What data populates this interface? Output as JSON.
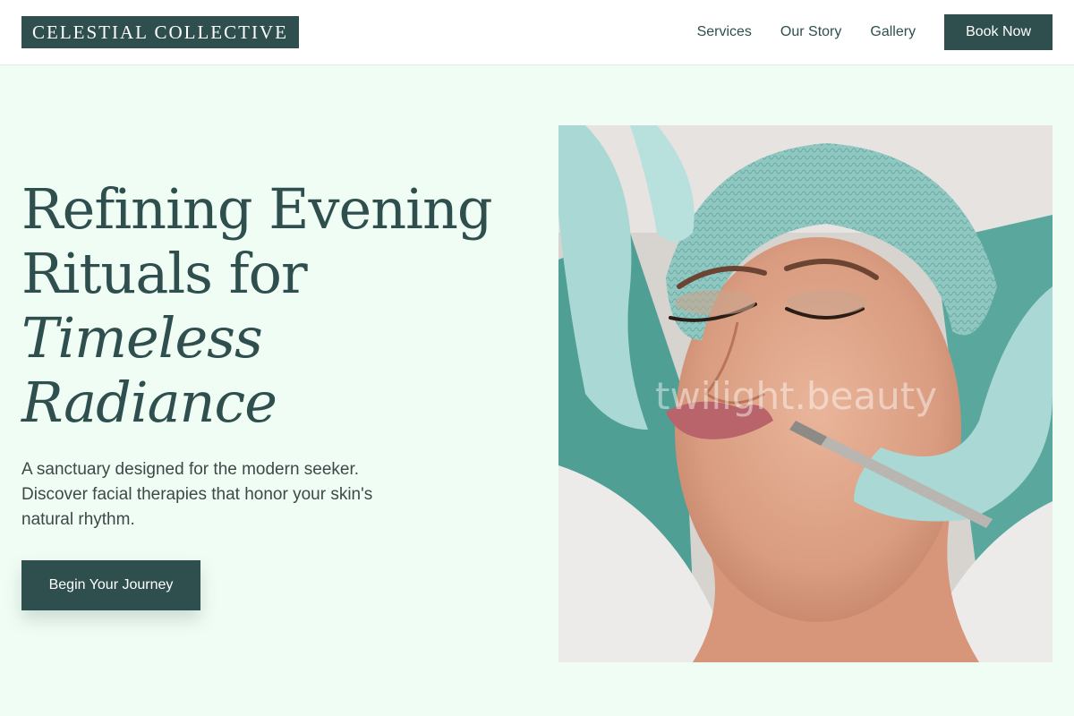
{
  "header": {
    "logo": "CELESTIAL COLLECTIVE",
    "nav": {
      "services": "Services",
      "our_story": "Our Story",
      "gallery": "Gallery"
    },
    "book_now": "Book Now"
  },
  "hero": {
    "title_line1": "Refining Evening",
    "title_line2": "Rituals for",
    "title_line3": "Timeless",
    "title_line4": "Radiance",
    "description": "A sanctuary designed for the modern seeker. Discover facial therapies that honor your skin's natural rhythm.",
    "cta": "Begin Your Journey",
    "image_watermark": "twilight.beauty"
  },
  "colors": {
    "primary": "#2f4f4f",
    "background": "#f0fdf4",
    "header_bg": "#ffffff",
    "body_text": "#3b4a48"
  }
}
